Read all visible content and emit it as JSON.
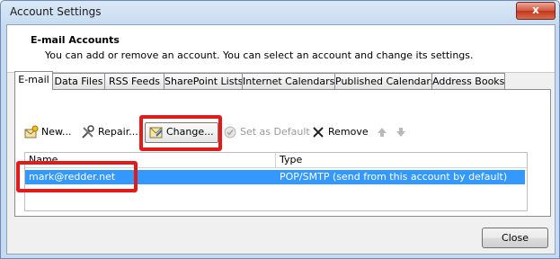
{
  "window": {
    "title": "Account Settings",
    "close_glyph": "x"
  },
  "header": {
    "title": "E-mail Accounts",
    "description": "You can add or remove an account. You can select an account and change its settings."
  },
  "tabs": [
    {
      "label": "E-mail",
      "active": true
    },
    {
      "label": "Data Files",
      "active": false
    },
    {
      "label": "RSS Feeds",
      "active": false
    },
    {
      "label": "SharePoint Lists",
      "active": false
    },
    {
      "label": "Internet Calendars",
      "active": false
    },
    {
      "label": "Published Calendars",
      "active": false
    },
    {
      "label": "Address Books",
      "active": false
    }
  ],
  "toolbar": {
    "new_label": "New...",
    "repair_label": "Repair...",
    "change_label": "Change...",
    "set_default_label": "Set as Default",
    "remove_label": "Remove",
    "new_icon": "new-account-icon",
    "repair_icon": "repair-tools-icon",
    "change_icon": "change-account-icon",
    "set_default_icon": "checkmark-icon",
    "remove_icon": "x-icon",
    "move_up_icon": "arrow-up-icon",
    "move_down_icon": "arrow-down-icon"
  },
  "accounts_table": {
    "columns": [
      "Name",
      "Type"
    ],
    "rows": [
      {
        "name": "mark@redder.net",
        "type": "POP/SMTP (send from this account by default)",
        "selected": true
      }
    ]
  },
  "footer": {
    "close_label": "Close"
  },
  "colors": {
    "highlight_red": "#e21a1a",
    "selection_blue": "#3399ff"
  }
}
